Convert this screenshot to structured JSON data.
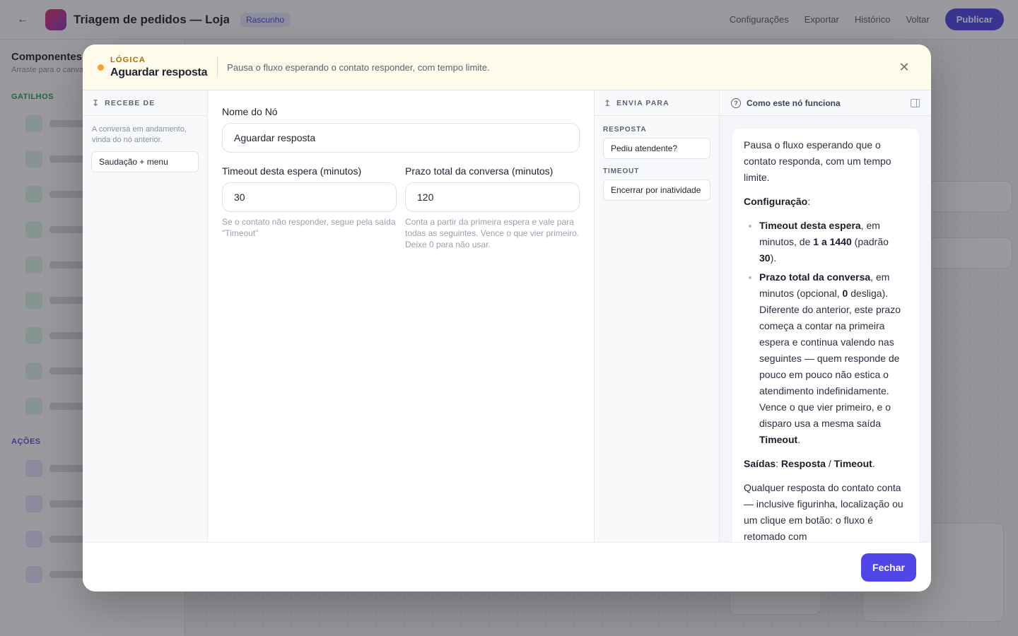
{
  "app": {
    "flow_title": "Triagem de pedidos — Loja ...",
    "flow_badge": "Rascunho",
    "actions": {
      "settings": "Configurações",
      "export": "Exportar",
      "history": "Histórico",
      "undo": "Voltar",
      "publish": "Publicar"
    },
    "sidebar": {
      "heading": "Componentes",
      "subheading": "Arraste para o canvas",
      "groups": [
        {
          "label": "GATILHOS"
        },
        {
          "label": "AÇÕES"
        }
      ]
    }
  },
  "modal": {
    "category": "LÓGICA",
    "title": "Aguardar resposta",
    "description": "Pausa o fluxo esperando o contato responder, com tempo limite.",
    "incoming": {
      "heading": "RECEBE DE",
      "note": "A conversa em andamento, vinda do nó anterior.",
      "source_node": "Saudação + menu"
    },
    "form": {
      "name_label": "Nome do Nó",
      "name_value": "Aguardar resposta",
      "timeout_label": "Timeout desta espera (minutos)",
      "timeout_value": "30",
      "timeout_help": "Se o contato não responder, segue pela saída \"Timeout\"",
      "deadline_label": "Prazo total da conversa (minutos)",
      "deadline_value": "120",
      "deadline_help": "Conta a partir da primeira espera e vale para todas as seguintes. Vence o que vier primeiro. Deixe 0 para não usar."
    },
    "outgoing": {
      "heading": "ENVIA PARA",
      "outputs": [
        {
          "label": "RESPOSTA",
          "target": "Pediu atendente?"
        },
        {
          "label": "TIMEOUT",
          "target": "Encerrar por inatividade"
        }
      ]
    },
    "help": {
      "heading": "Como este nó funciona",
      "intro": "Pausa o fluxo esperando que o contato responda, com um tempo limite.",
      "config_title": "Configuração",
      "config_colon": ":",
      "item1_bold": "Timeout desta espera",
      "item1_a": ", em minutos, de ",
      "item1_range": "1 a 1440",
      "item1_b": " (padrão ",
      "item1_default": "30",
      "item1_c": ").",
      "item2_bold": "Prazo total da conversa",
      "item2_a": ", em minutos (opcional, ",
      "item2_zero": "0",
      "item2_b": " desliga). Diferente do anterior, este prazo começa a contar na primeira espera e continua valendo nas seguintes — quem responde de pouco em pouco não estica o atendimento indefinidamente. Vence o que vier primeiro, e o disparo usa a mesma saída ",
      "item2_timeout": "Timeout",
      "item2_c": ".",
      "outputs_title": "Saídas",
      "outputs_colon": ": ",
      "outputs_resp": "Resposta",
      "outputs_sep": " / ",
      "outputs_timeout": "Timeout",
      "outputs_dot": ".",
      "closing": "Qualquer resposta do contato conta — inclusive figurinha, localização ou um clique em botão: o fluxo é retomado com"
    },
    "footer": {
      "close_label": "Fechar"
    }
  },
  "colors": {
    "accent": "#4f46e5",
    "logic": "#f5a524",
    "header_bg": "#fffbea"
  }
}
